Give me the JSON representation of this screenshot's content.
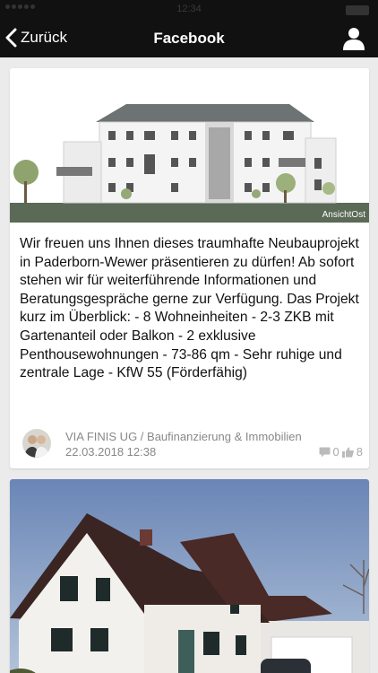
{
  "status_bar": {
    "time": "12:34"
  },
  "nav": {
    "back_label": "Zurück",
    "title": "Facebook"
  },
  "posts": [
    {
      "image_caption": "AnsichtOst",
      "text": "Wir freuen uns Ihnen dieses traumhafte Neubauprojekt in Paderborn-Wewer präsentieren zu dürfen! Ab sofort stehen wir für weiterführende Informationen und Beratungsgespräche gerne zur Verfügung. Das Projekt kurz im Überblick: - 8 Wohneinheiten - 2-3 ZKB mit Gartenanteil oder Balkon - 2 exklusive Penthousewohnungen - 73-86 qm - Sehr ruhige und zentrale Lage - KfW 55 (Förderfähig)",
      "author": "VIA FINIS UG / Baufinanzierung & Immobilien",
      "date": "22.03.2018 12:38",
      "comments": "0",
      "likes": "8"
    }
  ],
  "colors": {
    "bar": "#111111",
    "background": "#ebebeb",
    "meta": "#888888"
  }
}
